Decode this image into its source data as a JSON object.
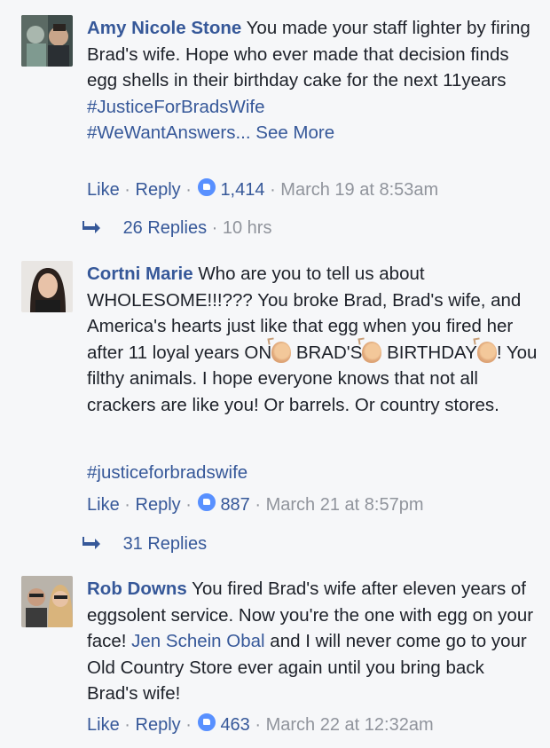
{
  "comments": [
    {
      "author": "Amy Nicole Stone",
      "text": "You made your staff lighter by firing Brad's wife. Hope who ever made that decision finds egg shells in their birthday cake for the next 11years",
      "hashtags": [
        "#JusticeForBradsWife",
        "#WeWantAnswers..."
      ],
      "see_more": "See More",
      "like_label": "Like",
      "reply_label": "Reply",
      "reaction_count": "1,414",
      "timestamp": "March 19 at 8:53am",
      "replies_label": "26 Replies",
      "replies_age": "10 hrs"
    },
    {
      "author": "Cortni Marie",
      "text_part1": "Who are you to tell us about WHOLESOME!!!??? You broke Brad, Brad's wife, and America's hearts just like that egg when you fired her after 11 loyal years ON",
      "text_part2": "BRAD'S",
      "text_part3": "BIRTHDAY",
      "text_part4": "! You filthy animals. I hope everyone knows that not all crackers are like you! Or barrels. Or country stores.",
      "hashtag": "#justiceforbradswife",
      "like_label": "Like",
      "reply_label": "Reply",
      "reaction_count": "887",
      "timestamp": "March 21 at 8:57pm",
      "replies_label": "31 Replies"
    },
    {
      "author": "Rob Downs",
      "text_part1": "You fired Brad's wife after eleven years of eggsolent service. Now you're the one with egg on your face!",
      "mention": "Jen Schein Obal",
      "text_part2": "and I will never come go to your Old Country Store ever again until you bring back Brad's wife!",
      "like_label": "Like",
      "reply_label": "Reply",
      "reaction_count": "463",
      "timestamp": "March 22 at 12:32am"
    }
  ],
  "colors": {
    "link": "#365899",
    "meta": "#90949c",
    "background": "#f6f7f9",
    "like_badge": "#5890ff"
  },
  "icons": {
    "reaction": "like-thumb-icon",
    "reply_arrow": "reply-arrow-icon",
    "emoji": "clapping-hands-icon"
  }
}
